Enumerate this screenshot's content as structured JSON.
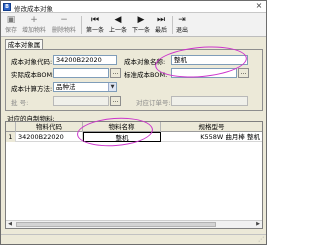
{
  "window": {
    "title": "修改成本对象",
    "close_glyph": "×",
    "icon_letter": "B"
  },
  "toolbar": {
    "buttons": [
      {
        "label": "保存",
        "glyph": "▣",
        "enabled": false
      },
      {
        "label": "增加物料",
        "glyph": "+",
        "enabled": false
      },
      {
        "label": "删除物料",
        "glyph": "−",
        "enabled": false
      },
      {
        "label": "第一条",
        "glyph": "⏮",
        "enabled": true
      },
      {
        "label": "上一条",
        "glyph": "◀",
        "enabled": true
      },
      {
        "label": "下一条",
        "glyph": "▶",
        "enabled": true
      },
      {
        "label": "最后",
        "glyph": "⏭",
        "enabled": true
      },
      {
        "label": "退出",
        "glyph": "⇥",
        "enabled": true
      }
    ]
  },
  "tabs": [
    {
      "label": "成本对象属性"
    }
  ],
  "form": {
    "code_label": "成本对象代码:",
    "code_value": "34200B22020",
    "name_label": "成本对象名称:",
    "name_value": "整机",
    "actual_label": "实际成本BOM:",
    "actual_value": "",
    "standard_label": "标准成本BOM:",
    "standard_value": "",
    "method_label": "成本计算方法:",
    "method_value": "品种法",
    "batch_label": "批    号:",
    "batch_value": "",
    "order_label": "对应订单号:",
    "order_value": ""
  },
  "grid": {
    "caption": "对应的自制物料:",
    "headers": [
      "物料代码",
      "物料名称",
      "规格型号"
    ],
    "rows": [
      {
        "index": "1",
        "code": "34200B22020",
        "name": "整机",
        "spec": "K558W 曲月棒 整机"
      }
    ]
  },
  "colors": {
    "highlight": "#cc33cc",
    "input_border": "#7f9db9",
    "window_bg": "#ece9d8"
  }
}
